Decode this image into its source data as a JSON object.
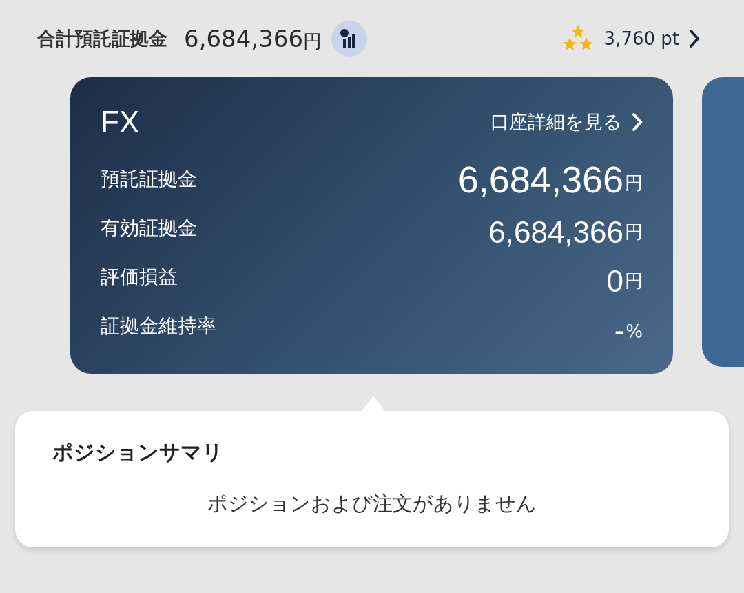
{
  "header": {
    "label": "合計預託証拠金",
    "value": "6,684,366",
    "unit": "円",
    "points": "3,760 pt"
  },
  "cards": [
    {
      "kind": "account",
      "title": "FX",
      "link": "口座詳細を見る",
      "rows": [
        {
          "label": "預託証拠金",
          "value": "6,684,366",
          "unit": "円",
          "emphasis": true
        },
        {
          "label": "有効証拠金",
          "value": "6,684,366",
          "unit": "円",
          "emphasis": false
        },
        {
          "label": "評価損益",
          "value": "0",
          "unit": "円",
          "emphasis": false
        },
        {
          "label": "証拠金維持率",
          "value": "-",
          "unit": "%",
          "emphasis": false
        }
      ]
    },
    {
      "kind": "peek"
    }
  ],
  "summary": {
    "title": "ポジションサマリ",
    "message": "ポジションおよび注文がありません"
  }
}
